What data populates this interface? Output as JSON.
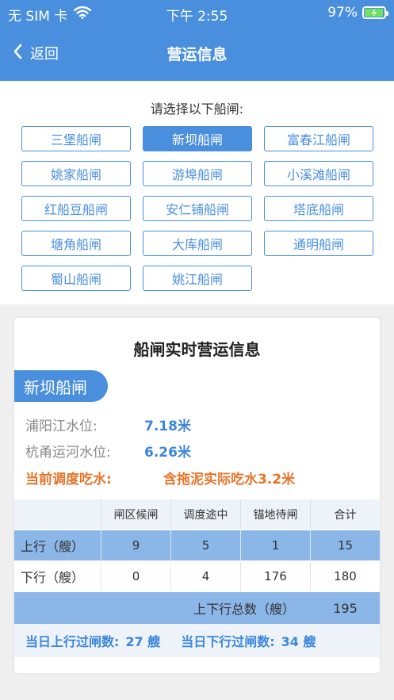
{
  "status_bar": {
    "carrier": "无 SIM 卡",
    "time": "下午 2:55",
    "battery": "97%",
    "battery_level": 0.97,
    "wifi_icon": "wifi-icon",
    "battery_icon": "battery-charging-icon"
  },
  "nav": {
    "back_label": "返回",
    "title": "营运信息"
  },
  "selector": {
    "prompt": "请选择以下船闸:",
    "locks": [
      "三堡船闸",
      "新坝船闸",
      "富春江船闸",
      "姚家船闸",
      "游埠船闸",
      "小溪滩船闸",
      "红船豆船闸",
      "安仁铺船闸",
      "塔底船闸",
      "塘角船闸",
      "大库船闸",
      "通明船闸",
      "蜀山船闸",
      "姚江船闸"
    ],
    "selected": "新坝船闸"
  },
  "card": {
    "title": "船闸实时营运信息",
    "lock_name": "新坝船闸",
    "puyang_label": "浦阳江水位:",
    "puyang_value": "7.18米",
    "hangyong_label": "杭甬运河水位:",
    "hangyong_value": "6.26米",
    "draft_label": "当前调度吃水:",
    "draft_value": "含拖泥实际吃水3.2米",
    "table": {
      "headers": [
        "",
        "闸区候闸",
        "调度途中",
        "锚地待闸",
        "合计"
      ],
      "rows": [
        [
          "上行（艘）",
          "9",
          "5",
          "1",
          "15"
        ],
        [
          "下行（艘）",
          "0",
          "4",
          "176",
          "180"
        ]
      ],
      "total_label": "上下行总数（艘）",
      "total_value": "195"
    },
    "pass": {
      "up_label": "当日上行过闸数:",
      "up_value": "27 艘",
      "down_label": "当日下行过闸数:",
      "down_value": "34 艘"
    }
  },
  "colors": {
    "primary": "#4a8fde",
    "highlight_row": "#8bb6e8",
    "orange": "#e8742a",
    "battery": "#6ce35a"
  }
}
